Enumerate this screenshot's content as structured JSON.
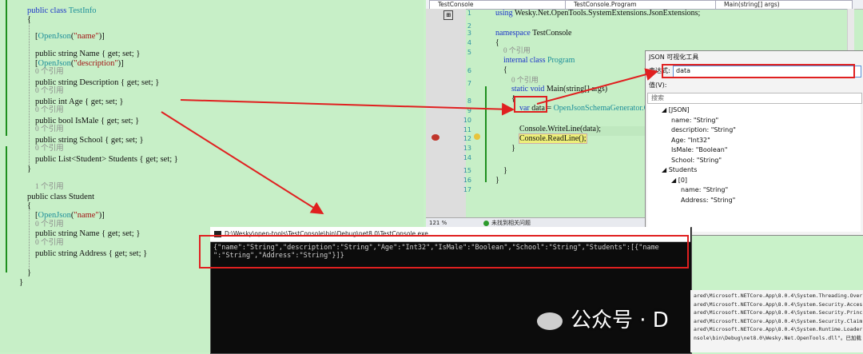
{
  "left_code": {
    "lines": [
      {
        "kw": "public class ",
        "ty": "TestInfo"
      },
      {
        "text": "{"
      },
      {
        "text": ""
      },
      {
        "attr": "[OpenJson(\"name\")]"
      },
      {
        "text": "public string Name { get; set; }"
      },
      {
        "attr": "[OpenJson(\"description\")]"
      },
      {
        "ref": "0 个引用"
      },
      {
        "text": "public string Description { get; set; }"
      },
      {
        "ref": "0 个引用"
      },
      {
        "text": "public int Age { get; set; }"
      },
      {
        "ref": "0 个引用"
      },
      {
        "text": "public bool IsMale { get; set; }"
      },
      {
        "ref": "0 个引用"
      },
      {
        "text": "public string School { get; set; }"
      },
      {
        "ref": "0 个引用"
      },
      {
        "text": "public List<Student> Students { get; set; }"
      },
      {
        "text": "}"
      },
      {
        "text": ""
      },
      {
        "ref": "1 个引用"
      },
      {
        "text": "public class Student"
      },
      {
        "text": "{"
      },
      {
        "attr": "[OpenJson(\"name\")]"
      },
      {
        "ref": "0 个引用"
      },
      {
        "text": "public string Name { get; set; }"
      },
      {
        "ref": "0 个引用"
      },
      {
        "text": "public string Address { get; set; }"
      },
      {
        "text": ""
      },
      {
        "text": "}"
      },
      {
        "text": "}"
      }
    ]
  },
  "editor": {
    "nav": {
      "project": "TestConsole",
      "class": "TestConsole.Program",
      "member": "Main(string[] args)"
    },
    "line_numbers": [
      "1",
      "2",
      "3",
      "4",
      "5",
      "6",
      "7",
      "8",
      "9",
      "10",
      "11",
      "12",
      "13",
      "14",
      "15",
      "16",
      "17"
    ],
    "lines": [
      "using Wesky.Net.OpenTools.SystemExtensions.JsonExtensions;",
      "",
      "namespace TestConsole",
      "{",
      "0 个引用",
      "internal class Program",
      "{",
      "0 个引用",
      "static void Main(string[] args)",
      "{",
      "var data = OpenJsonSchemaGenerator.C",
      "",
      "Console.WriteLine(data);",
      "Console.ReadLine();",
      "}",
      "",
      "}",
      "}"
    ],
    "status": {
      "zoom": "121 %",
      "issues": "未找到相关问题"
    }
  },
  "json_tool": {
    "title": "JSON 可视化工具",
    "expr_label": "表达式:",
    "expr_value": "data",
    "value_label": "值(V):",
    "search_placeholder": "搜索",
    "tree": [
      "◢ [JSON]",
      "name: \"String\"",
      "description: \"String\"",
      "Age: \"Int32\"",
      "IsMale: \"Boolean\"",
      "School: \"String\"",
      "◢ Students",
      "◢ [0]",
      "name: \"String\"",
      "Address: \"String\""
    ]
  },
  "console": {
    "title": "D:\\Wesky\\open-tools\\TestConsole\\bin\\Debug\\net8.0\\TestConsole.exe",
    "line1": "{\"name\":\"String\",\"description\":\"String\",\"Age\":\"Int32\",\"IsMale\":\"Boolean\",\"School\":\"String\",\"Students\":[{\"name",
    "line2": "\":\"String\",\"Address\":\"String\"}]}"
  },
  "output": {
    "lines": [
      "ared\\Microsoft.NETCore.App\\8.0.4\\System.Threading.Overl",
      "ared\\Microsoft.NETCore.App\\8.0.4\\System.Security.Access",
      "ared\\Microsoft.NETCore.App\\8.0.4\\System.Security.Princi",
      "ared\\Microsoft.NETCore.App\\8.0.4\\System.Security.Claims.",
      "ared\\Microsoft.NETCore.App\\8.0.4\\System.Runtime.Loader.",
      "nsole\\bin\\Debug\\net8.0\\Wesky.Net.OpenTools.dll\"。已加载"
    ]
  },
  "watermark": "公众号 · D",
  "colors": {
    "arrow": "#e02020",
    "editor_bg": "#c7efc7"
  }
}
